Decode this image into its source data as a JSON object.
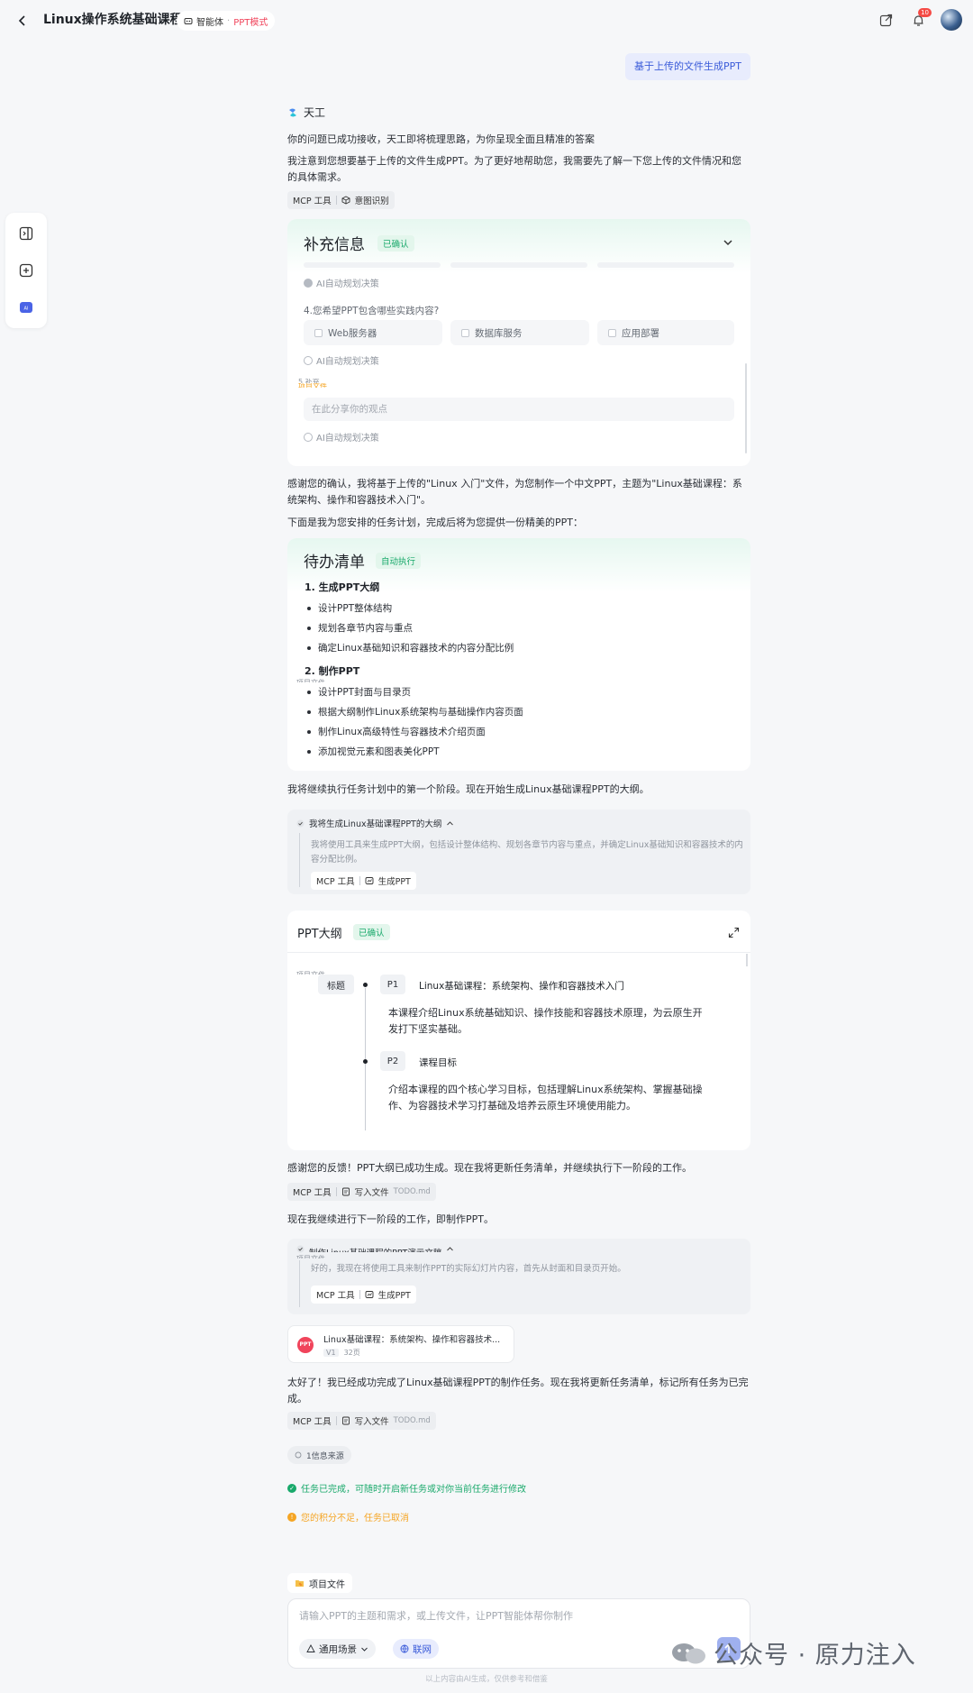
{
  "header": {
    "title": "Linux操作系统基础课程",
    "mode_agent": "智能体",
    "mode_sep": "·",
    "mode_name": "PPT模式",
    "notif_count": "10"
  },
  "user_message": "基于上传的文件生成PPT",
  "agent": {
    "name": "天工",
    "intro_1": "你的问题已成功接收，天工即将梳理思路，为你呈现全面且精准的答案",
    "intro_2": "我注意到您想要基于上传的文件生成PPT。为了更好地帮助您，我需要先了解一下您上传的文件情况和您的具体需求。",
    "tool_mcp": "MCP 工具",
    "tool_intent": "意图识别"
  },
  "supplement": {
    "title": "补充信息",
    "status": "已确认",
    "ai_auto": "AI自动规划决策",
    "question_4": "4.您希望PPT包含哪些实践内容?",
    "options": [
      "Web服务器",
      "数据库服务",
      "应用部署"
    ],
    "overlap_text_a": "5.补充",
    "overlap_text_b": "项目文件",
    "share_placeholder": "在此分享你的观点"
  },
  "reply_1": "感谢您的确认，我将基于上传的\"Linux 入门\"文件，为您制作一个中文PPT，主题为\"Linux基础课程：系统架构、操作和容器技术入门\"。",
  "reply_2": "下面是我为您安排的任务计划，完成后将为您提供一份精美的PPT：",
  "todo": {
    "title": "待办清单",
    "status": "自动执行",
    "sections": [
      {
        "name": "1. 生成PPT大纲",
        "items": [
          "设计PPT整体结构",
          "规划各章节内容与重点",
          "确定Linux基础知识和容器技术的内容分配比例"
        ]
      },
      {
        "name": "2. 制作PPT",
        "items": [
          "设计PPT封面与目录页",
          "根据大纲制作Linux系统架构与基础操作内容页面",
          "制作Linux高级特性与容器技术介绍页面",
          "添加视觉元素和图表美化PPT"
        ]
      }
    ],
    "overlap_text": "项目文件"
  },
  "reply_3": "我将继续执行任务计划中的第一个阶段。现在开始生成Linux基础课程PPT的大纲。",
  "step_1": {
    "head": "我将生成Linux基础课程PPT的大纲",
    "text": "我将使用工具来生成PPT大纲，包括设计整体结构、规划各章节内容与重点，并确定Linux基础知识和容器技术的内容分配比例。",
    "tool_mcp": "MCP 工具",
    "tool_name": "生成PPT"
  },
  "outline": {
    "title": "PPT大纲",
    "status": "已确认",
    "overlap_text": "项目文件",
    "root": "标题",
    "pages": [
      {
        "id": "P1",
        "title": "Linux基础课程：系统架构、操作和容器技术入门",
        "desc": "本课程介绍Linux系统基础知识、操作技能和容器技术原理，为云原生开发打下坚实基础。"
      },
      {
        "id": "P2",
        "title": "课程目标",
        "desc": "介绍本课程的四个核心学习目标，包括理解Linux系统架构、掌握基础操作、为容器技术学习打基础及培养云原生环境使用能力。"
      }
    ]
  },
  "reply_4": "感谢您的反馈！PPT大纲已成功生成。现在我将更新任务清单，并继续执行下一阶段的工作。",
  "tool_write_1": {
    "mcp": "MCP 工具",
    "name": "写入文件",
    "file": "TODO.md"
  },
  "reply_5": "现在我继续进行下一阶段的工作，即制作PPT。",
  "step_2": {
    "head": "制作Linux基础课程的PPT演示文稿",
    "overlap_text": "项目文件",
    "text": "好的，我现在将使用工具来制作PPT的实际幻灯片内容，首先从封面和目录页开始。",
    "tool_mcp": "MCP 工具",
    "tool_name": "生成PPT"
  },
  "ppt_file": {
    "logo": "PPT",
    "name": "Linux基础课程：系统架构、操作和容器技术...",
    "version": "V1",
    "pages": "32页"
  },
  "reply_6": "太好了！我已经成功完成了Linux基础课程PPT的制作任务。现在我将更新任务清单，标记所有任务为已完成。",
  "tool_write_2": {
    "mcp": "MCP 工具",
    "name": "写入文件",
    "file": "TODO.md"
  },
  "sources": "1信息来源",
  "status_done": "任务已完成，可随时开启新任务或对你当前任务进行修改",
  "status_cancel": "您的积分不足，任务已取消",
  "composer": {
    "project_chip": "项目文件",
    "placeholder": "请输入PPT的主题和需求，或上传文件，让PPT智能体帮你制作",
    "scene": "通用场景",
    "network": "联网"
  },
  "disclaimer": "以上内容由AI生成，仅供参考和借鉴",
  "watermark": "公众号 · 原力注入",
  "colors": {
    "accent": "#3a5bd9",
    "success": "#19a96b",
    "warning": "#f5a524",
    "brand_red": "#f0445b"
  }
}
